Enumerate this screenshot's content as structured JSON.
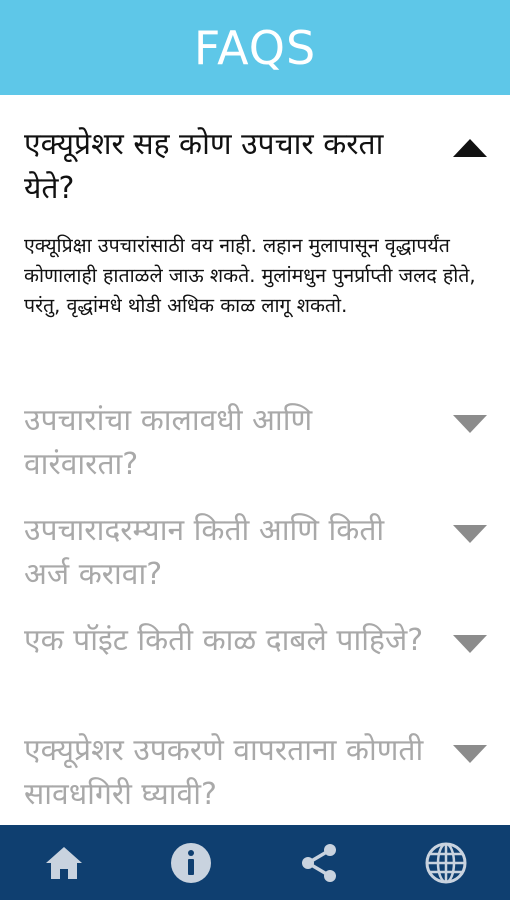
{
  "header": {
    "title": "FAQS"
  },
  "faqs": [
    {
      "question": "एक्यूप्रेशर सह कोण उपचार करता येते?",
      "answer": "एक्यूप्रिक्षा उपचारांसाठी वय नाही. लहान मुलापासून वृद्धापर्यंत कोणालाही हाताळले जाऊ शकते. मुलांमधुन पुनर्प्राप्ती जलद होते, परंतु, वृद्धांमधे थोडी अधिक काळ लागू शकतो.",
      "expanded": true
    },
    {
      "question": "उपचारांचा कालावधी आणि वारंवारता?",
      "expanded": false
    },
    {
      "question": "उपचारादरम्यान किती आणि किती अर्ज करावा?",
      "expanded": false
    },
    {
      "question": "एक पॉइंट किती काळ दाबले पाहिजे?",
      "expanded": false
    },
    {
      "question": "एक्यूप्रेशर उपकरणे वापरताना कोणती सावधगिरी घ्यावी?",
      "expanded": false
    }
  ],
  "bottom_nav": [
    {
      "icon": "home-icon"
    },
    {
      "icon": "info-icon"
    },
    {
      "icon": "share-icon"
    },
    {
      "icon": "globe-icon"
    }
  ],
  "colors": {
    "header_bg": "#5ec7e8",
    "bottom_bar_bg": "#0f3f70",
    "nav_icon": "#c9d3df",
    "question_open": "#111111",
    "question_closed": "#a9a9a9"
  }
}
